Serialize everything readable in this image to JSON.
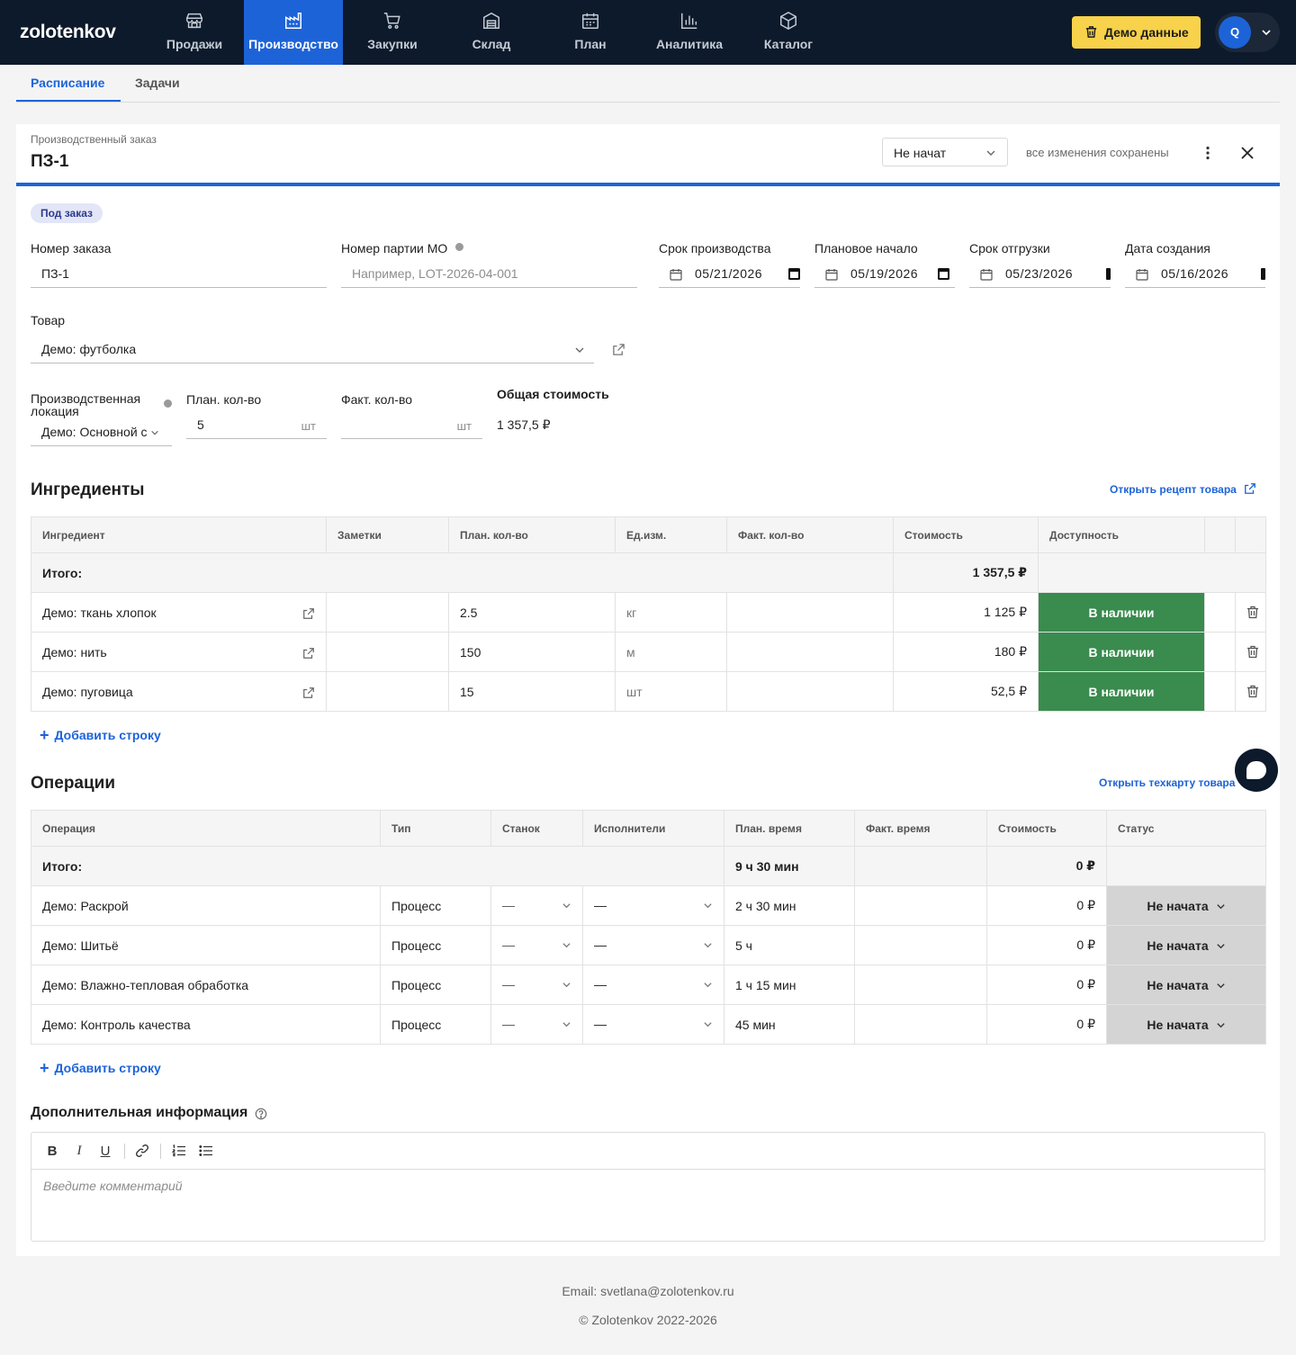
{
  "brand": "zolotenkov",
  "nav": [
    {
      "label": "Продажи",
      "icon": "store-icon"
    },
    {
      "label": "Производство",
      "icon": "factory-icon"
    },
    {
      "label": "Закупки",
      "icon": "cart-icon"
    },
    {
      "label": "Склад",
      "icon": "warehouse-icon"
    },
    {
      "label": "План",
      "icon": "calendar-icon"
    },
    {
      "label": "Аналитика",
      "icon": "chart-icon"
    },
    {
      "label": "Каталог",
      "icon": "box-icon"
    }
  ],
  "demo_button": "Демо данные",
  "user_initial": "Q",
  "subtabs": [
    "Расписание",
    "Задачи"
  ],
  "order": {
    "subtitle": "Производственный заказ",
    "title": "ПЗ-1",
    "status": "Не начат",
    "saved_text": "все изменения сохранены",
    "badge": "Под заказ"
  },
  "fields": {
    "order_number": {
      "label": "Номер заказа",
      "value": "ПЗ-1"
    },
    "batch_number": {
      "label": "Номер партии МО",
      "placeholder": "Например, LOT-2026-04-001"
    },
    "production_deadline": {
      "label": "Срок производства",
      "value": "05/21/2026"
    },
    "planned_start": {
      "label": "Плановое начало",
      "value": "05/19/2026"
    },
    "shipment_deadline": {
      "label": "Срок отгрузки",
      "value": "05/23/2026"
    },
    "created_date": {
      "label": "Дата создания",
      "value": "05/16/2026"
    },
    "product": {
      "label": "Товар",
      "value": "Демо: футболка"
    },
    "location": {
      "label": "Производственная локация",
      "value": "Демо: Основной с"
    },
    "plan_qty": {
      "label": "План. кол-во",
      "value": "5",
      "unit": "шт"
    },
    "fact_qty": {
      "label": "Факт. кол-во",
      "value": "",
      "unit": "шт"
    },
    "total_cost": {
      "label": "Общая стоимость",
      "value": "1 357,5 ₽"
    }
  },
  "ingredients": {
    "title": "Ингредиенты",
    "link": "Открыть рецепт товара",
    "columns": [
      "Ингредиент",
      "Заметки",
      "План. кол-во",
      "Ед.изм.",
      "Факт. кол-во",
      "Стоимость",
      "Доступность"
    ],
    "total_label": "Итого:",
    "total_cost": "1 357,5 ₽",
    "rows": [
      {
        "name": "Демо: ткань хлопок",
        "notes": "",
        "plan": "2.5",
        "unit": "кг",
        "fact": "",
        "cost": "1 125 ₽",
        "availability": "В наличии"
      },
      {
        "name": "Демо: нить",
        "notes": "",
        "plan": "150",
        "unit": "м",
        "fact": "",
        "cost": "180 ₽",
        "availability": "В наличии"
      },
      {
        "name": "Демо: пуговица",
        "notes": "",
        "plan": "15",
        "unit": "шт",
        "fact": "",
        "cost": "52,5 ₽",
        "availability": "В наличии"
      }
    ],
    "add_row": "Добавить строку"
  },
  "operations": {
    "title": "Операции",
    "link": "Открыть техкарту товара",
    "columns": [
      "Операция",
      "Тип",
      "Станок",
      "Исполнители",
      "План. время",
      "Факт. время",
      "Стоимость",
      "Статус"
    ],
    "total_label": "Итого:",
    "total_time": "9 ч 30 мин",
    "total_cost": "0 ₽",
    "rows": [
      {
        "name": "Демо: Раскрой",
        "type": "Процесс",
        "machine": "—",
        "workers": "—",
        "plan_time": "2 ч 30 мин",
        "fact_time": "",
        "cost": "0 ₽",
        "status": "Не начата"
      },
      {
        "name": "Демо: Шитьё",
        "type": "Процесс",
        "machine": "—",
        "workers": "—",
        "plan_time": "5 ч",
        "fact_time": "",
        "cost": "0 ₽",
        "status": "Не начата"
      },
      {
        "name": "Демо: Влажно-тепловая обработка",
        "type": "Процесс",
        "machine": "—",
        "workers": "—",
        "plan_time": "1 ч 15 мин",
        "fact_time": "",
        "cost": "0 ₽",
        "status": "Не начата"
      },
      {
        "name": "Демо: Контроль качества",
        "type": "Процесс",
        "machine": "—",
        "workers": "—",
        "plan_time": "45 мин",
        "fact_time": "",
        "cost": "0 ₽",
        "status": "Не начата"
      }
    ],
    "add_row": "Добавить строку"
  },
  "additional": {
    "title": "Дополнительная информация",
    "placeholder": "Введите комментарий"
  },
  "footer": {
    "email": "Email: svetlana@zolotenkov.ru",
    "copyright": "© Zolotenkov 2022-2026"
  },
  "colors": {
    "nav_bg": "#0d1a2b",
    "accent": "#1d63d8",
    "demo_button": "#f7d24a",
    "available": "#3a8b4e",
    "status_gray": "#d4d4d4"
  }
}
